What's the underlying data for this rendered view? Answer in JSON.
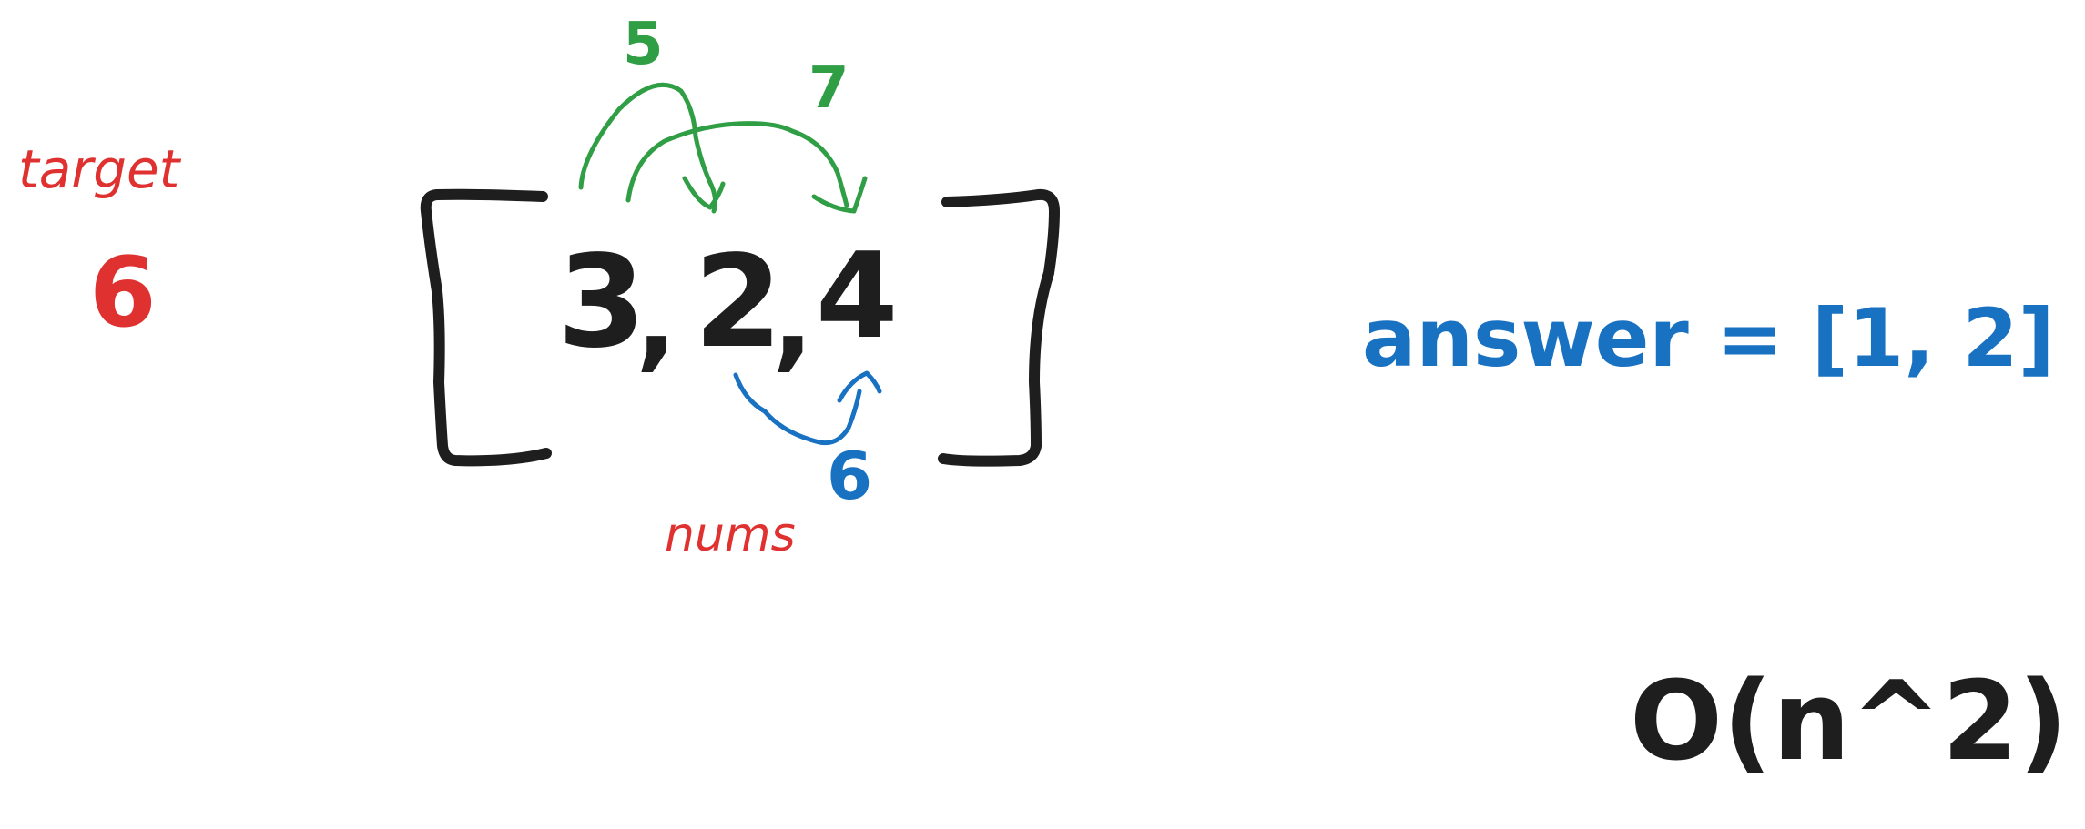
{
  "colors": {
    "ink": "#1e1e1e",
    "red": "#e03131",
    "green": "#2f9e44",
    "blue": "#1971c2",
    "background": "#ffffff"
  },
  "target": {
    "label": "target",
    "value": "6"
  },
  "nums": {
    "label": "nums",
    "values": [
      "3",
      "2",
      "4"
    ],
    "separator": ","
  },
  "pair_sums": {
    "first": "5",
    "second": "7",
    "third": "6"
  },
  "answer": {
    "text": "answer = [1, 2]"
  },
  "complexity": {
    "text": "O(n^2)"
  }
}
